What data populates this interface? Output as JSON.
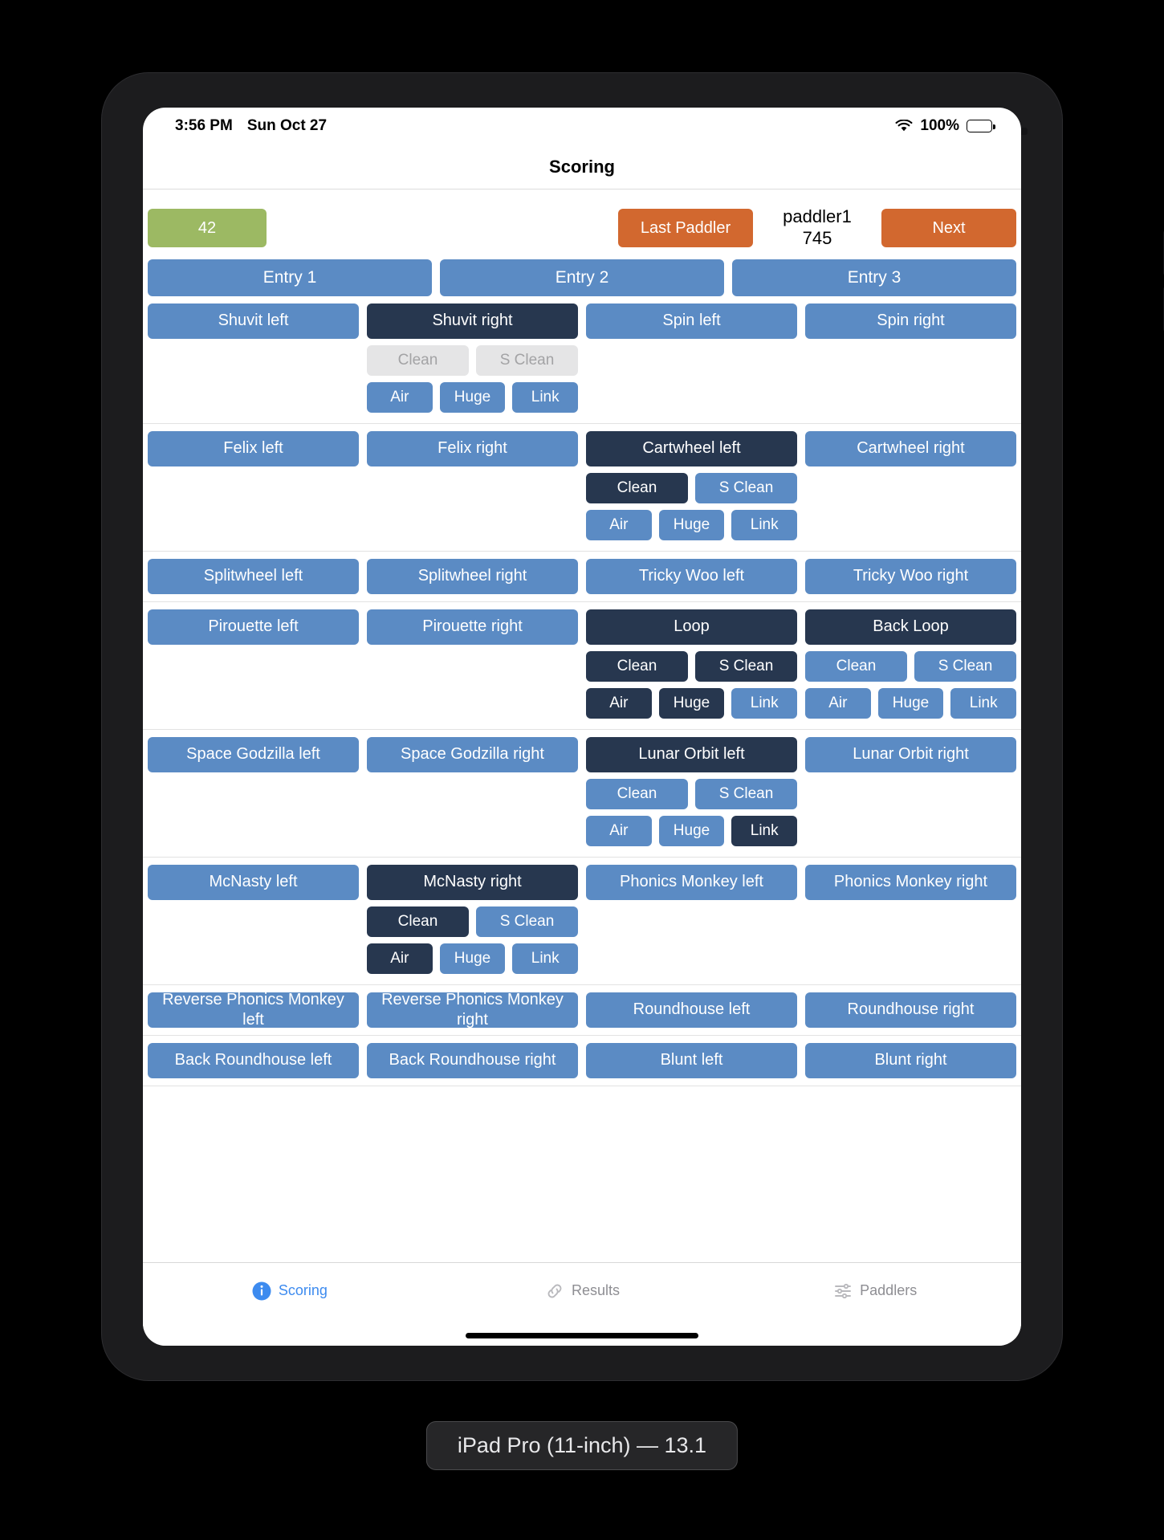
{
  "status_bar": {
    "time": "3:56 PM",
    "date": "Sun Oct 27",
    "battery_percent": "100%",
    "wifi_icon": "wifi-icon",
    "battery_icon": "battery-full-icon"
  },
  "nav": {
    "title": "Scoring"
  },
  "header": {
    "score": "42",
    "last_paddler_label": "Last Paddler",
    "paddler_name": "paddler1",
    "paddler_number": "745",
    "next_label": "Next"
  },
  "entries": [
    {
      "label": "Entry 1",
      "state": "blue"
    },
    {
      "label": "Entry 2",
      "state": "blue"
    },
    {
      "label": "Entry 3",
      "state": "blue"
    }
  ],
  "sub_labels": {
    "clean": "Clean",
    "s_clean": "S Clean",
    "air": "Air",
    "huge": "Huge",
    "link": "Link"
  },
  "trick_rows": [
    {
      "tricks": [
        {
          "label": "Shuvit left",
          "state": "blue"
        },
        {
          "label": "Shuvit right",
          "state": "dark",
          "options": {
            "clean": "disabled",
            "s_clean": "disabled",
            "air": "blue",
            "huge": "blue",
            "link": "blue"
          }
        },
        {
          "label": "Spin left",
          "state": "blue"
        },
        {
          "label": "Spin right",
          "state": "blue"
        }
      ]
    },
    {
      "tricks": [
        {
          "label": "Felix left",
          "state": "blue"
        },
        {
          "label": "Felix right",
          "state": "blue"
        },
        {
          "label": "Cartwheel left",
          "state": "dark",
          "options": {
            "clean": "dark",
            "s_clean": "blue",
            "air": "blue",
            "huge": "blue",
            "link": "blue"
          }
        },
        {
          "label": "Cartwheel right",
          "state": "blue"
        }
      ]
    },
    {
      "tricks": [
        {
          "label": "Splitwheel left",
          "state": "blue"
        },
        {
          "label": "Splitwheel right",
          "state": "blue"
        },
        {
          "label": "Tricky Woo left",
          "state": "blue"
        },
        {
          "label": "Tricky Woo right",
          "state": "blue"
        }
      ]
    },
    {
      "tricks": [
        {
          "label": "Pirouette left",
          "state": "blue"
        },
        {
          "label": "Pirouette right",
          "state": "blue"
        },
        {
          "label": "Loop",
          "state": "dark",
          "options": {
            "clean": "dark",
            "s_clean": "dark",
            "air": "dark",
            "huge": "dark",
            "link": "blue"
          }
        },
        {
          "label": "Back Loop",
          "state": "dark",
          "options": {
            "clean": "blue",
            "s_clean": "blue",
            "air": "blue",
            "huge": "blue",
            "link": "blue"
          }
        }
      ]
    },
    {
      "tricks": [
        {
          "label": "Space Godzilla left",
          "state": "blue"
        },
        {
          "label": "Space Godzilla right",
          "state": "blue"
        },
        {
          "label": "Lunar Orbit left",
          "state": "dark",
          "options": {
            "clean": "blue",
            "s_clean": "blue",
            "air": "blue",
            "huge": "blue",
            "link": "dark"
          }
        },
        {
          "label": "Lunar Orbit right",
          "state": "blue"
        }
      ]
    },
    {
      "tricks": [
        {
          "label": "McNasty left",
          "state": "blue"
        },
        {
          "label": "McNasty right",
          "state": "dark",
          "options": {
            "clean": "dark",
            "s_clean": "blue",
            "air": "dark",
            "huge": "blue",
            "link": "blue"
          }
        },
        {
          "label": "Phonics Monkey left",
          "state": "blue"
        },
        {
          "label": "Phonics Monkey right",
          "state": "blue"
        }
      ]
    },
    {
      "tricks": [
        {
          "label": "Reverse Phonics Monkey left",
          "state": "blue"
        },
        {
          "label": "Reverse Phonics Monkey right",
          "state": "blue"
        },
        {
          "label": "Roundhouse left",
          "state": "blue"
        },
        {
          "label": "Roundhouse right",
          "state": "blue"
        }
      ]
    },
    {
      "tricks": [
        {
          "label": "Back Roundhouse left",
          "state": "blue"
        },
        {
          "label": "Back Roundhouse right",
          "state": "blue"
        },
        {
          "label": "Blunt left",
          "state": "blue"
        },
        {
          "label": "Blunt right",
          "state": "blue"
        }
      ]
    }
  ],
  "tabs": [
    {
      "label": "Scoring",
      "icon": "info-circle-icon",
      "active": true
    },
    {
      "label": "Results",
      "icon": "link-chain-icon",
      "active": false
    },
    {
      "label": "Paddlers",
      "icon": "sliders-icon",
      "active": false
    }
  ],
  "device_caption": "iPad Pro (11-inch) — 13.1",
  "colors": {
    "blue": "#5b8bc4",
    "dark": "#27374f",
    "green": "#9cb963",
    "orange": "#d2682f",
    "disabled_bg": "#e5e5e6",
    "disabled_text": "#a3a3a5",
    "tab_active": "#3d8bef",
    "tab_inactive": "#8e8e93"
  }
}
